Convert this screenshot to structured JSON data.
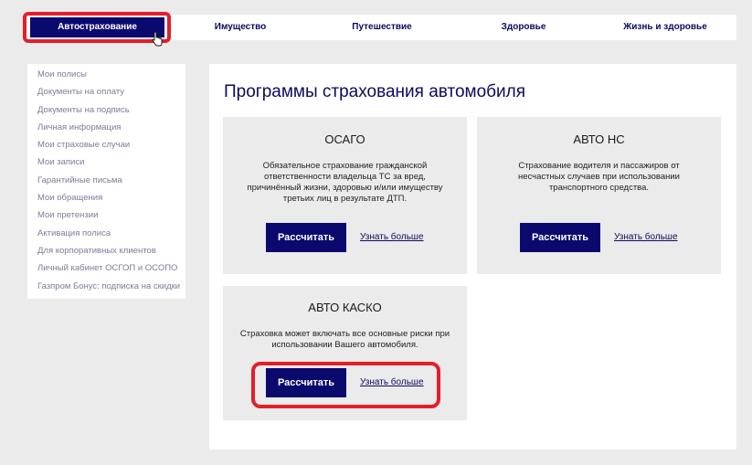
{
  "nav": {
    "tabs": [
      {
        "label": "Автострахование",
        "active": true
      },
      {
        "label": "Имущество"
      },
      {
        "label": "Путешествие"
      },
      {
        "label": "Здоровье"
      },
      {
        "label": "Жизнь и здоровье"
      }
    ]
  },
  "sidebar": {
    "items": [
      {
        "label": "Мои полисы"
      },
      {
        "label": "Документы на оплату"
      },
      {
        "label": "Документы на подпись"
      },
      {
        "label": "Личная информация"
      },
      {
        "label": "Мои страховые случаи"
      },
      {
        "label": "Мои записи"
      },
      {
        "label": "Гарантийные письма"
      },
      {
        "label": "Мои обращения"
      },
      {
        "label": "Мои претензии"
      },
      {
        "label": "Активация полиса"
      },
      {
        "label": "Для корпоративных клиентов"
      },
      {
        "label": "Личный кабинет ОСГОП и ОСОПО"
      },
      {
        "label": "Газпром Бонус: подписка на скидки"
      }
    ]
  },
  "main": {
    "title": "Программы страхования автомобиля",
    "cards": [
      {
        "title": "ОСАГО",
        "description": [
          "Обязательное страхование гражданской",
          "ответственности владельца ТС за вред,",
          "причинённый жизни, здоровью и/или имуществу",
          "третьих лиц в результате ДТП."
        ],
        "calc_label": "Рассчитать",
        "more_label": "Узнать больше"
      },
      {
        "title": "АВТО НС",
        "description": [
          "Страхование водителя и пассажиров от",
          "несчастных случаев при использовании",
          "транспортного средства."
        ],
        "calc_label": "Рассчитать",
        "more_label": "Узнать больше"
      },
      {
        "title": "АВТО КАСКО",
        "description": [
          "Страховка может включать все основные риски при",
          "использовании Вашего автомобиля."
        ],
        "calc_label": "Рассчитать",
        "more_label": "Узнать больше"
      }
    ]
  },
  "colors": {
    "brand": "#0a0a6e",
    "highlight": "#e41e2b",
    "sidebar_text": "#7c7c9a"
  }
}
